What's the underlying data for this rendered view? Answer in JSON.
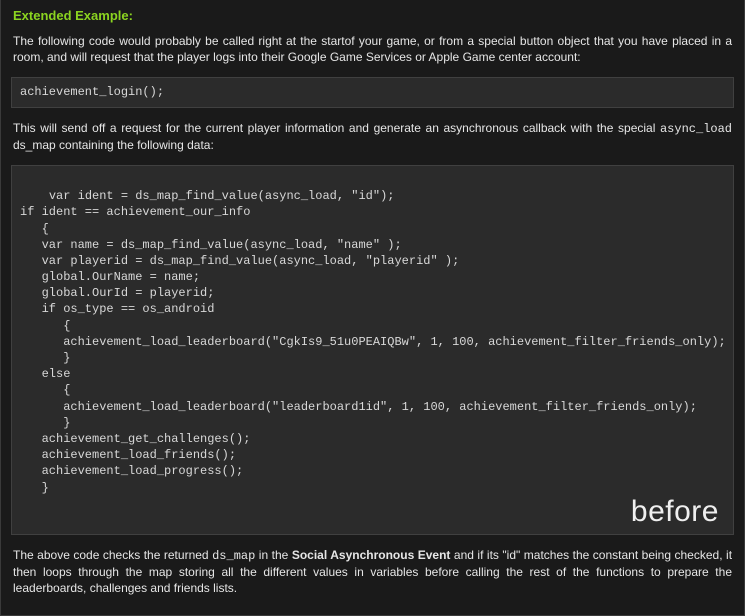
{
  "heading": "Extended Example:",
  "para1": "The following code would probably be called right at the startof your game, or from a special button object that you have placed in a room, and will request that the player logs into their Google Game Services or Apple Game center account:",
  "code1": "achievement_login();",
  "para2_pre": "This will send off a request for the current player information and generate an asynchronous callback with the special ",
  "para2_code": "async_load",
  "para2_post": " ds_map containing the following data:",
  "code2": "var ident = ds_map_find_value(async_load, \"id\");\nif ident == achievement_our_info\n   {\n   var name = ds_map_find_value(async_load, \"name\" );\n   var playerid = ds_map_find_value(async_load, \"playerid\" );\n   global.OurName = name;\n   global.OurId = playerid;\n   if os_type == os_android\n      {\n      achievement_load_leaderboard(\"CgkIs9_51u0PEAIQBw\", 1, 100, achievement_filter_friends_only);\n      }\n   else\n      {\n      achievement_load_leaderboard(\"leaderboard1id\", 1, 100, achievement_filter_friends_only);\n      }\n   achievement_get_challenges();\n   achievement_load_friends();\n   achievement_load_progress();\n   }",
  "watermark": "before",
  "para3_a": "The above code checks the returned ",
  "para3_code": "ds_map",
  "para3_b": " in the ",
  "para3_bold": "Social Asynchronous Event",
  "para3_c": " and if its \"id\" matches the constant being checked, it then loops through the map storing all the different values in variables before calling the rest of the functions to prepare the leaderboards, challenges and friends lists."
}
